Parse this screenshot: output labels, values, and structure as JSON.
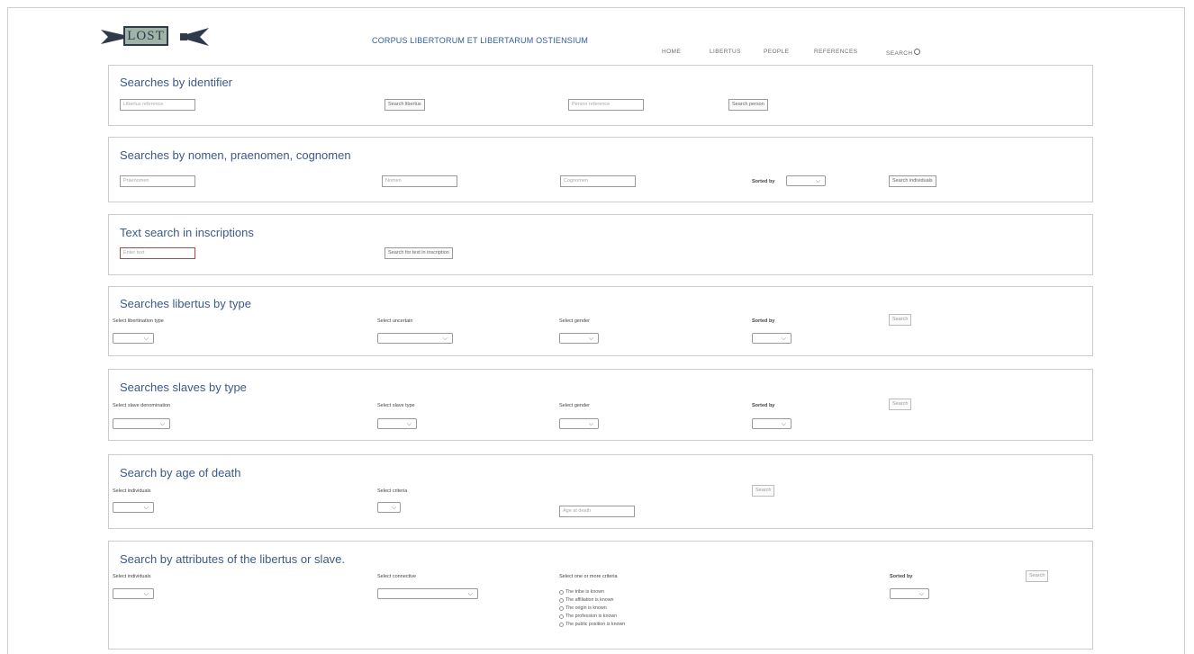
{
  "header": {
    "logo_text": "LOST",
    "site_title": "CORPUS LIBERTORUM ET LIBERTARUM OSTIENSIUM",
    "nav": [
      "HOME",
      "LIBERTUS",
      "PEOPLE",
      "REFERENCES",
      "SEARCH"
    ]
  },
  "identifier": {
    "title": "Searches by identifier",
    "libertus_placeholder": "Libertus reference",
    "libertus_button": "Search libertus",
    "person_placeholder": "Person reference",
    "person_button": "Search person"
  },
  "names": {
    "title": "Searches by nomen, praenomen, cognomen",
    "praenomen_placeholder": "Praenomen",
    "nomen_placeholder": "Nomen",
    "cognomen_placeholder": "Cognomen",
    "sorted_by_label": "Sorted by",
    "button": "Search individuals"
  },
  "text_search": {
    "title": "Text search in inscriptions",
    "placeholder": "Enter text",
    "button": "Search for text in inscription"
  },
  "libertus_type": {
    "title": "Searches libertus by type",
    "labels": [
      "Select libertination type",
      "Select uncertain",
      "Select gender",
      "Sorted by"
    ],
    "button": "Search"
  },
  "slaves_type": {
    "title": "Searches slaves by type",
    "labels": [
      "Select slave denomination",
      "Select slave type",
      "Select gender",
      "Sorted by"
    ],
    "button": "Search"
  },
  "age_death": {
    "title": "Search by age of death",
    "labels": [
      "Select individuals",
      "Select criteria"
    ],
    "age_placeholder": "Age at death",
    "button": "Search"
  },
  "attributes": {
    "title": "Search by attributes of the libertus or slave.",
    "labels": [
      "Select individuals",
      "Select connective",
      "Select one or more criteria",
      "Sorted by"
    ],
    "criteria": [
      "The tribe is known",
      "The affiliation is known",
      "The origin is known",
      "The profession is known",
      "The public position is known"
    ],
    "button": "Search"
  }
}
